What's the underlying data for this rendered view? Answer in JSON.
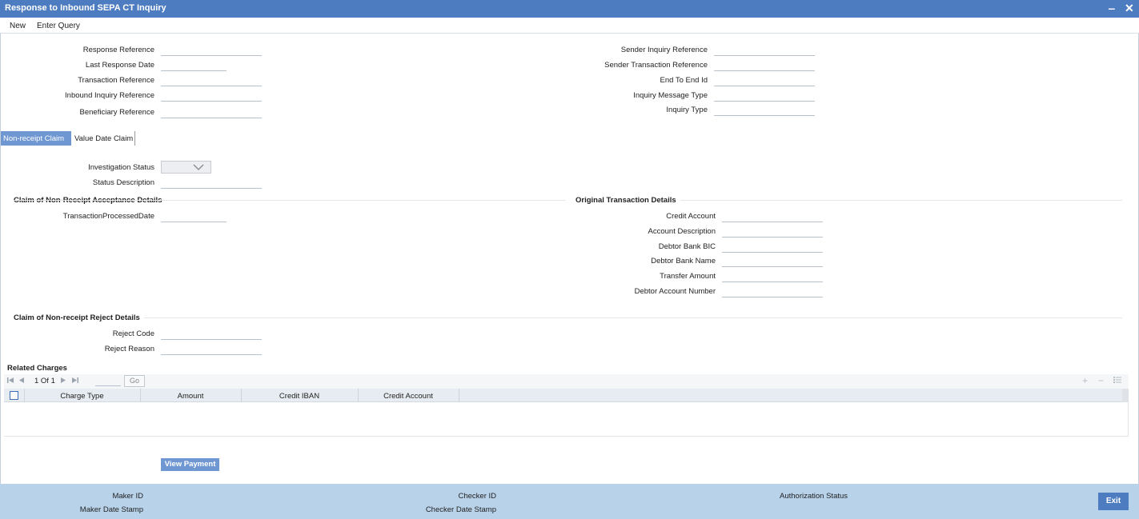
{
  "window": {
    "title": "Response to Inbound SEPA CT Inquiry",
    "minimize_glyph": "‒",
    "close_glyph": "✕"
  },
  "menu": {
    "new": "New",
    "enter_query": "Enter Query"
  },
  "header_left": {
    "response_reference": "Response Reference",
    "last_response_date": "Last Response Date",
    "transaction_reference": "Transaction Reference",
    "inbound_inquiry_reference": "Inbound Inquiry Reference",
    "beneficiary_reference": "Beneficiary Reference"
  },
  "header_right": {
    "sender_inquiry_reference": "Sender Inquiry Reference",
    "sender_transaction_reference": "Sender Transaction Reference",
    "end_to_end_id": "End To End Id",
    "inquiry_message_type": "Inquiry Message Type",
    "inquiry_type": "Inquiry Type"
  },
  "tabs": {
    "non_receipt_claim": "Non-receipt Claim",
    "value_date_claim": "Value Date Claim"
  },
  "investigation": {
    "investigation_status": "Investigation Status",
    "status_description": "Status Description"
  },
  "acceptance_section": {
    "title": "Claim of Non-Receipt Acceptance Details",
    "transaction_processed_date": "TransactionProcessedDate"
  },
  "original_section": {
    "title": "Original Transaction Details",
    "credit_account": "Credit Account",
    "account_description": "Account Description",
    "debtor_bank_bic": "Debtor Bank BIC",
    "debtor_bank_name": "Debtor Bank Name",
    "transfer_amount": "Transfer Amount",
    "debtor_account_number": "Debtor Account Number"
  },
  "reject_section": {
    "title": "Claim of Non-receipt Reject Details",
    "reject_code": "Reject Code",
    "reject_reason": "Reject Reason"
  },
  "related_charges": {
    "title": "Related Charges",
    "page_text": "1 Of 1",
    "go_label": "Go",
    "columns": [
      "Charge Type",
      "Amount",
      "Credit IBAN",
      "Credit Account"
    ]
  },
  "buttons": {
    "view_payment": "View Payment",
    "exit": "Exit"
  },
  "footer": {
    "maker_id": "Maker ID",
    "maker_date_stamp": "Maker Date Stamp",
    "checker_id": "Checker ID",
    "checker_date_stamp": "Checker Date Stamp",
    "authorization_status": "Authorization Status"
  },
  "colors": {
    "title_bar": "#4d7cc0",
    "active_tab": "#6f97d2",
    "footer": "#b8d2ea"
  }
}
